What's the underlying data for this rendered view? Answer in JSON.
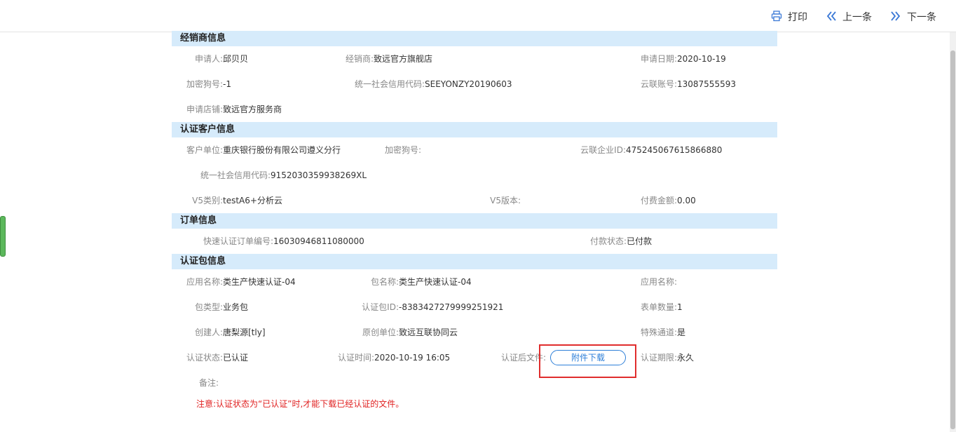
{
  "toolbar": {
    "print": "打印",
    "prev": "上一条",
    "next": "下一条"
  },
  "sections": {
    "dealer": {
      "title": "经销商信息",
      "applicant_label": "申请人:",
      "applicant": "邱贝贝",
      "dealer_label": "经销商:",
      "dealer": "致远官方旗舰店",
      "date_label": "申请日期:",
      "date": "2020-10-19",
      "dongle_label": "加密狗号:",
      "dongle": "-1",
      "credit_label": "统一社会信用代码:",
      "credit": "SEEYONZY20190603",
      "cloud_label": "云联账号:",
      "cloud": "13087555593",
      "store_label": "申请店铺:",
      "store": "致远官方服务商"
    },
    "customer": {
      "title": "认证客户信息",
      "unit_label": "客户单位:",
      "unit": "重庆银行股份有限公司遵义分行",
      "dongle_label": "加密狗号:",
      "dongle": "",
      "enterprise_label": "云联企业ID:",
      "enterprise": "475245067615866880",
      "credit_label": "统一社会信用代码:",
      "credit": "9152030359938269XL",
      "v5type_label": "V5类别:",
      "v5type": "testA6+分析云",
      "v5ver_label": "V5版本:",
      "v5ver": "",
      "fee_label": "付费金额:",
      "fee": "0.00"
    },
    "order": {
      "title": "订单信息",
      "orderno_label": "快速认证订单编号:",
      "orderno": "16030946811080000",
      "paystatus_label": "付款状态:",
      "paystatus": "已付款"
    },
    "package": {
      "title": "认证包信息",
      "app_label": "应用名称:",
      "app": "类生产快速认证-04",
      "pkg_label": "包名称:",
      "pkg": "类生产快速认证-04",
      "app2_label": "应用名称:",
      "app2": "",
      "ptype_label": "包类型:",
      "ptype": "业务包",
      "pid_label": "认证包ID:",
      "pid": "-8383427279999251921",
      "forms_label": "表单数量:",
      "forms": "1",
      "creator_label": "创建人:",
      "creator": "唐梨源[tly]",
      "orig_label": "原创单位:",
      "orig": "致远互联协同云",
      "special_label": "特殊通道:",
      "special": "是",
      "status_label": "认证状态:",
      "status": "已认证",
      "time_label": "认证时间:",
      "time": "2020-10-19 16:05",
      "file_label": "认证后文件:",
      "download": "附件下载",
      "period_label": "认证期限:",
      "period": "永久",
      "remark_label": "备注:",
      "remark": "",
      "notice": "注意:认证状态为“已认证”时,才能下载已经认证的文件。"
    }
  },
  "colors": {
    "section_bg": "#d6ebfb",
    "accent": "#2d7fd8",
    "highlight": "#e02d2d"
  }
}
